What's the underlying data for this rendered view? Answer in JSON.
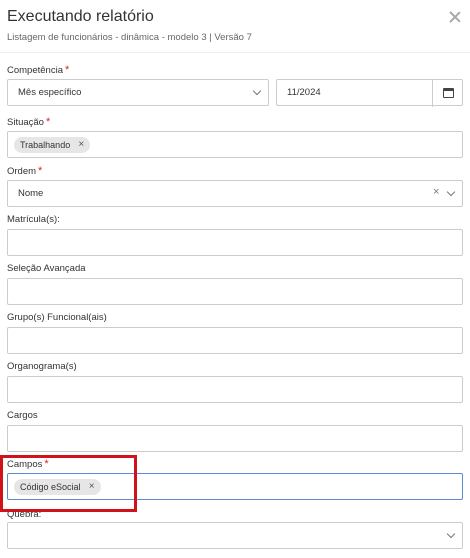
{
  "header": {
    "title": "Executando relatório",
    "subtitle": "Listagem de funcionários - dinâmica - modelo 3 | Versão 7"
  },
  "fields": {
    "competencia": {
      "label": "Competência",
      "required": "*",
      "select_value": "Mês específico",
      "date_value": "11/2024"
    },
    "situacao": {
      "label": "Situação",
      "required": "*",
      "chip": "Trabalhando",
      "chip_remove": "×"
    },
    "ordem": {
      "label": "Ordem",
      "required": "*",
      "value": "Nome",
      "clear": "×"
    },
    "matricula": {
      "label": "Matrícula(s):"
    },
    "selecao": {
      "label": "Seleção Avançada"
    },
    "grupo": {
      "label": "Grupo(s) Funcional(ais)"
    },
    "organograma": {
      "label": "Organograma(s)"
    },
    "cargos": {
      "label": "Cargos"
    },
    "campos": {
      "label": "Campos",
      "required": "*",
      "chip": "Código eSocial",
      "chip_remove": "×"
    },
    "quebra": {
      "label": "Quebra:"
    }
  },
  "icons": {
    "close": "close-icon",
    "calendar": "calendar-icon",
    "chevron": "chevron-down-icon"
  },
  "colors": {
    "highlight": "#d0121b",
    "required": "#dd2222",
    "focus_border": "#5b8bd0"
  }
}
